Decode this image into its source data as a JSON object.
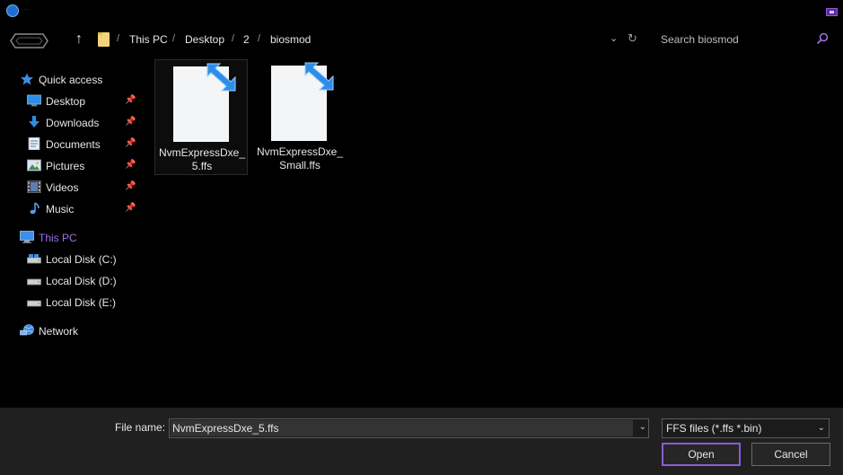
{
  "window": {
    "title": "...",
    "accent_color": "#8a5ad6"
  },
  "breadcrumb": {
    "items": [
      "This PC",
      "Desktop",
      "2",
      "biosmod"
    ],
    "separator": "/"
  },
  "search": {
    "placeholder": "Search biosmod"
  },
  "sidebar": {
    "quick_access": {
      "label": "Quick access",
      "icon": "star-icon"
    },
    "pinned": [
      {
        "label": "Desktop",
        "icon": "desktop-icon"
      },
      {
        "label": "Downloads",
        "icon": "download-icon"
      },
      {
        "label": "Documents",
        "icon": "documents-icon"
      },
      {
        "label": "Pictures",
        "icon": "pictures-icon"
      },
      {
        "label": "Videos",
        "icon": "videos-icon"
      },
      {
        "label": "Music",
        "icon": "music-icon"
      }
    ],
    "this_pc": {
      "label": "This PC",
      "icon": "computer-icon",
      "selected": true
    },
    "drives": [
      {
        "label": "Local Disk (C:)",
        "icon": "drive-icon"
      },
      {
        "label": "Local Disk (D:)",
        "icon": "drive-icon"
      },
      {
        "label": "Local Disk (E:)",
        "icon": "drive-icon"
      }
    ],
    "network": {
      "label": "Network",
      "icon": "network-icon"
    }
  },
  "files": [
    {
      "name": "NvmExpressDxe_5.ffs",
      "line1": "NvmExpressDxe_",
      "line2": "5.ffs",
      "icon": "ffs-file-icon",
      "selected": true
    },
    {
      "name": "NvmExpressDxe_Small.ffs",
      "line1": "NvmExpressDxe_",
      "line2": "Small.ffs",
      "icon": "ffs-file-icon",
      "selected": false
    }
  ],
  "footer": {
    "filename_label": "File name:",
    "filename_value": "NvmExpressDxe_5.ffs",
    "filter_value": "FFS files (*.ffs *.bin)",
    "open_label": "Open",
    "cancel_label": "Cancel"
  }
}
